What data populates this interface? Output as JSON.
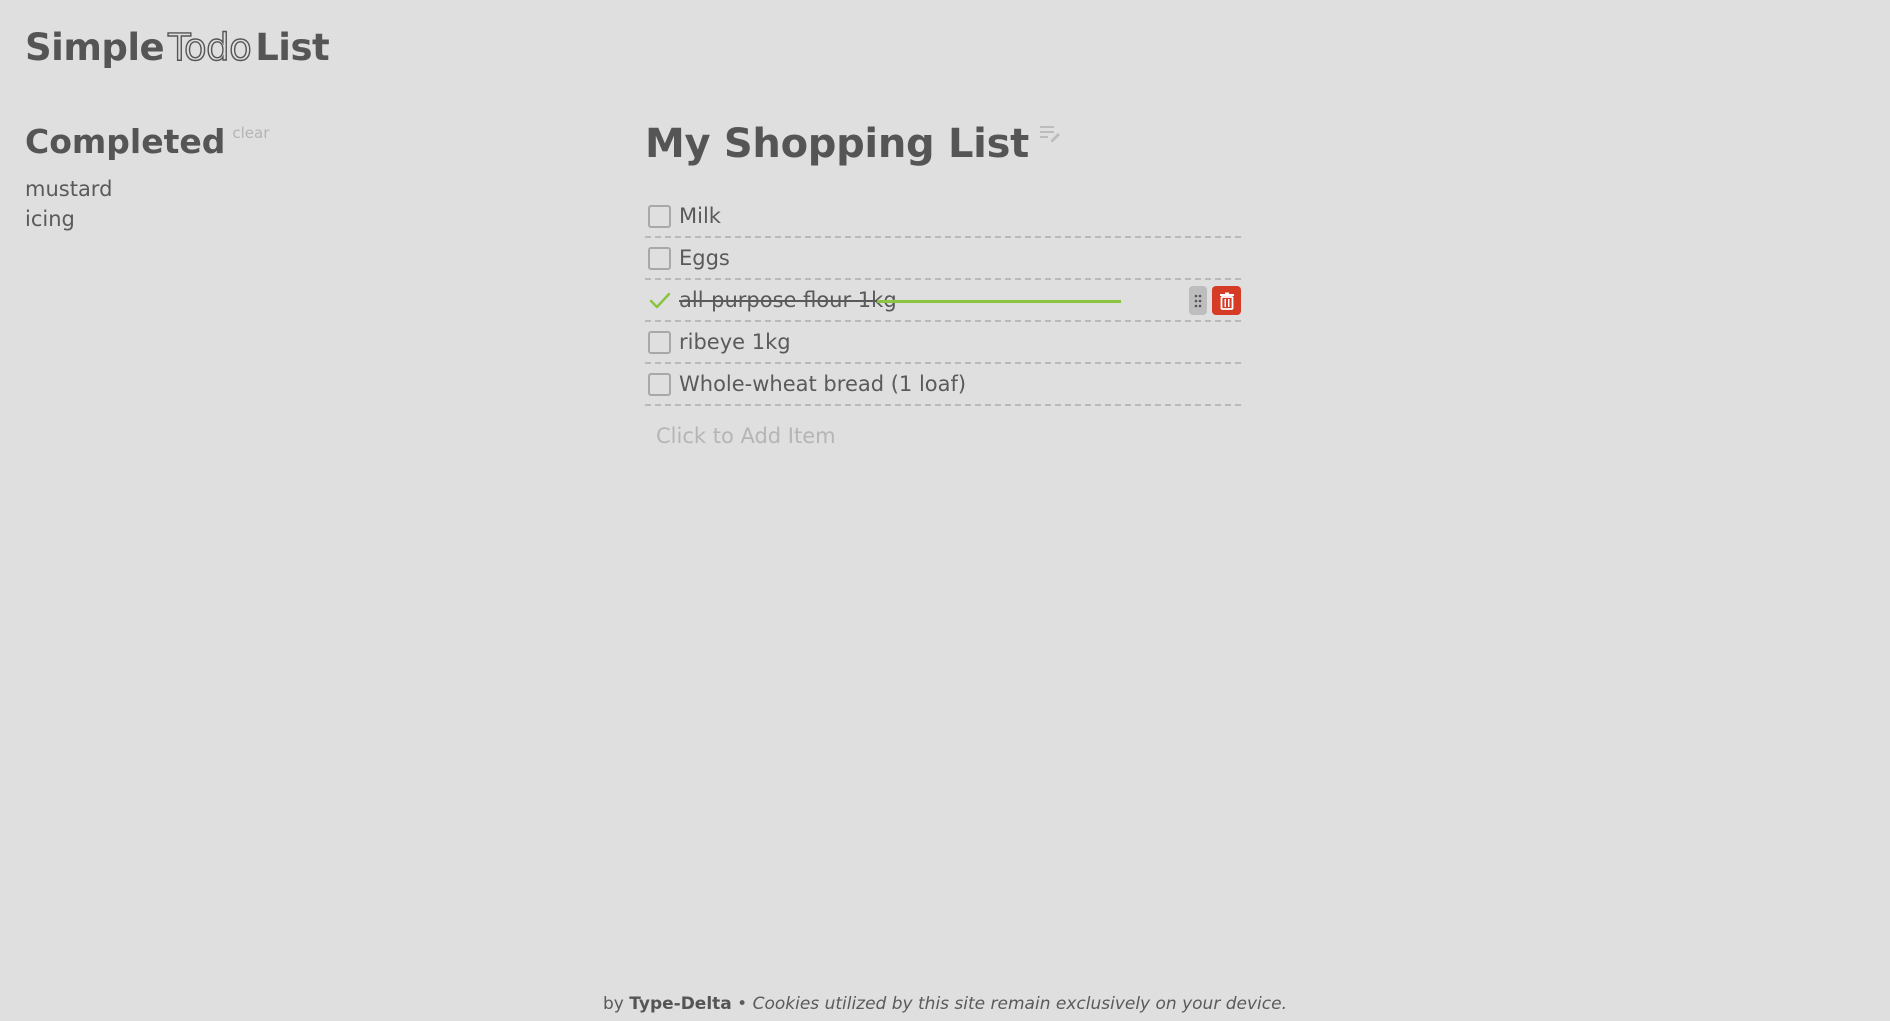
{
  "app": {
    "title_part1": "Simple",
    "title_part2": "Todo",
    "title_part3": "List"
  },
  "completed": {
    "heading": "Completed",
    "clear_label": "clear",
    "items": [
      "mustard",
      "icing"
    ]
  },
  "list": {
    "title": "My Shopping List",
    "items": [
      {
        "label": "Milk",
        "done": false
      },
      {
        "label": "Eggs",
        "done": false
      },
      {
        "label": "all-purpose flour 1kg",
        "done": true
      },
      {
        "label": "ribeye 1kg",
        "done": false
      },
      {
        "label": "Whole-wheat bread (1 loaf)",
        "done": false
      }
    ],
    "add_placeholder": "Click to Add Item"
  },
  "footer": {
    "by": "by",
    "brand": "Type-Delta",
    "separator": "•",
    "note": "Cookies utilized by this site remain exclusively on your device."
  },
  "colors": {
    "background": "#dfdfdf",
    "text": "#5a5a5a",
    "check_green": "#8ac53f",
    "delete_red": "#d63b26"
  },
  "icons": {
    "edit": "edit-list-icon",
    "check": "check-icon",
    "drag": "drag-handle-icon",
    "delete": "trash-icon"
  }
}
